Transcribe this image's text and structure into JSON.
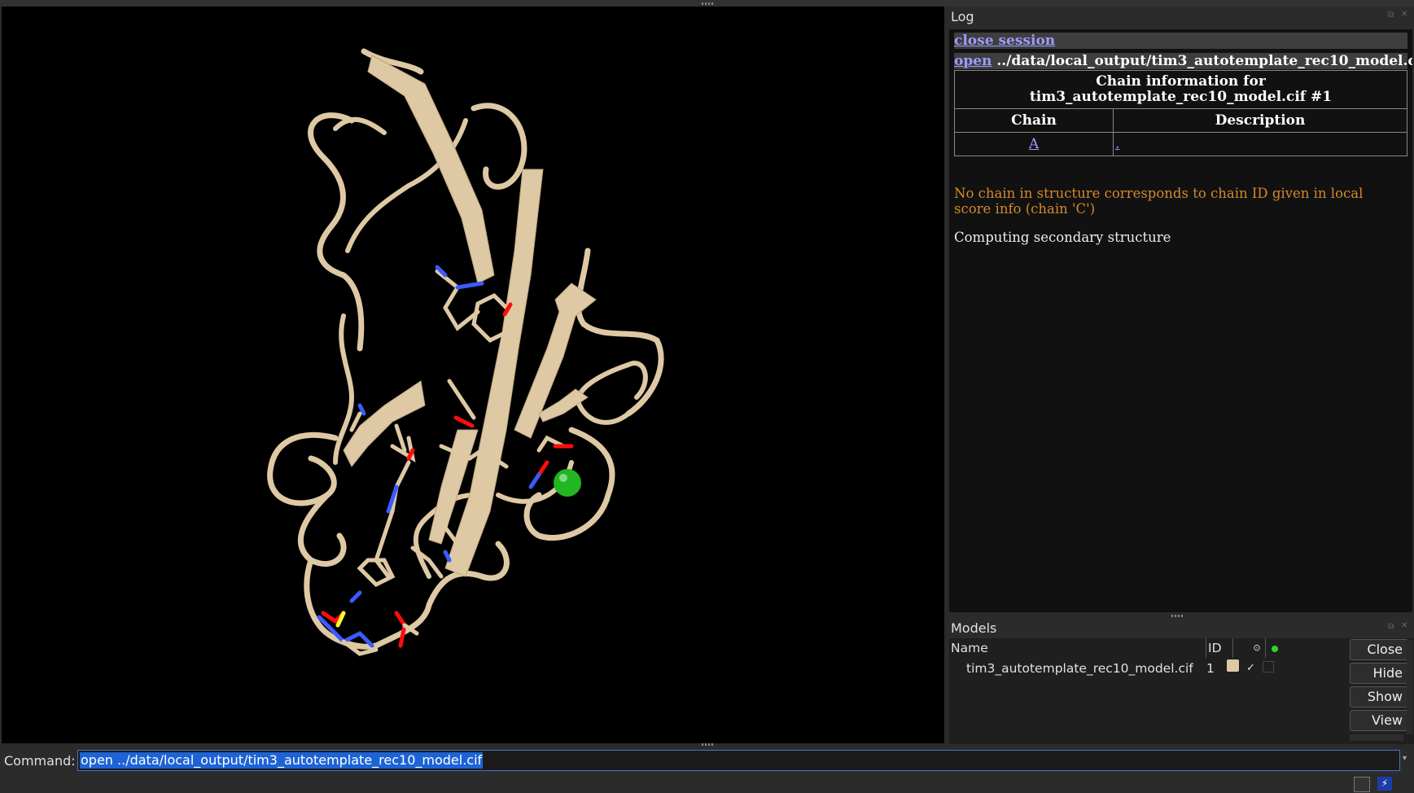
{
  "log": {
    "title": "Log",
    "close_cmd": "close session",
    "open_cmd": "open",
    "open_path": "../data/local_output/tim3_autotemplate_rec10_model.cif",
    "table_title": "Chain information for tim3_autotemplate_rec10_model.cif #1",
    "col_chain": "Chain",
    "col_description": "Description",
    "chain_id": "A",
    "chain_desc": ".",
    "warning": "No chain in structure corresponds to chain ID given in local score info (chain 'C')",
    "info": "Computing secondary structure"
  },
  "models": {
    "title": "Models",
    "col_name": "Name",
    "col_id": "ID",
    "row_name": "tim3_autotemplate_rec10_model.cif",
    "row_id": "1",
    "row_check": "✓",
    "buttons": [
      "Close",
      "Hide",
      "Show",
      "View"
    ]
  },
  "command": {
    "label": "Command:",
    "value": "open ../data/local_output/tim3_autotemplate_rec10_model.cif"
  },
  "colors": {
    "ribbon": "#dec9a4",
    "nitrogen": "#3a5bff",
    "oxygen": "#ff0d0d",
    "sulfur": "#ffff30",
    "ion": "#22b622",
    "link": "#9c9cff",
    "warning": "#d4892c"
  }
}
